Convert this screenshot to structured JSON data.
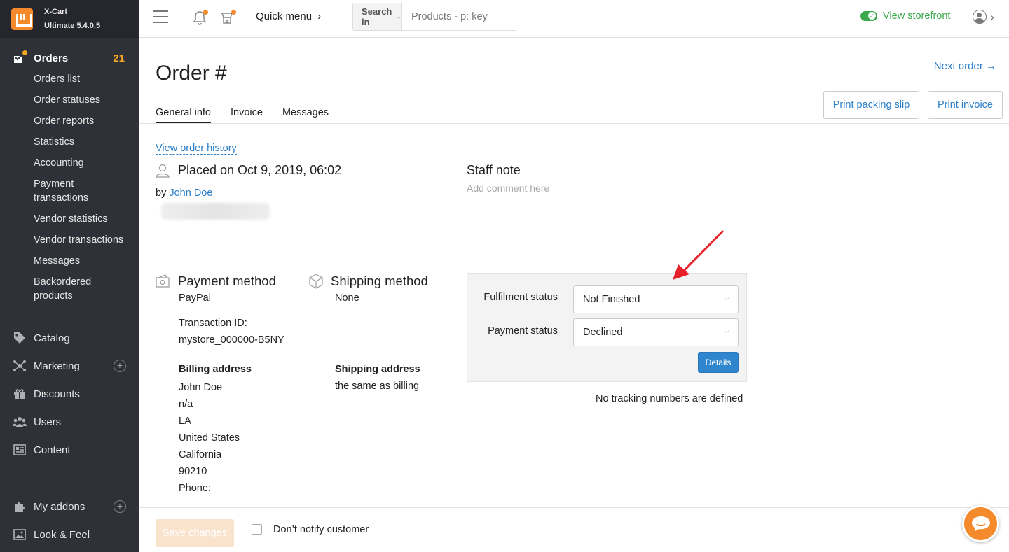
{
  "brand": {
    "name": "X-Cart",
    "edition": "Ultimate 5.4.0.5"
  },
  "sidebar": {
    "orders": {
      "label": "Orders",
      "count": "21"
    },
    "order_items": [
      {
        "label": "Orders list"
      },
      {
        "label": "Order statuses"
      },
      {
        "label": "Order reports"
      },
      {
        "label": "Statistics"
      },
      {
        "label": "Accounting"
      },
      {
        "label": "Payment transactions"
      },
      {
        "label": "Vendor statistics"
      },
      {
        "label": "Vendor transactions"
      },
      {
        "label": "Messages"
      },
      {
        "label": "Backordered products"
      }
    ],
    "sections": [
      {
        "label": "Catalog",
        "icon": "tag-icon"
      },
      {
        "label": "Marketing",
        "icon": "network-icon"
      },
      {
        "label": "Discounts",
        "icon": "gift-icon"
      },
      {
        "label": "Users",
        "icon": "users-icon"
      },
      {
        "label": "Content",
        "icon": "content-icon"
      }
    ],
    "bottom_sections": [
      {
        "label": "My addons",
        "icon": "puzzle-icon"
      },
      {
        "label": "Look & Feel",
        "icon": "image-icon"
      }
    ]
  },
  "topbar": {
    "quick_menu": "Quick menu",
    "search_in": "Search in",
    "search_placeholder": "Products - p: key",
    "view_storefront": "View storefront"
  },
  "order": {
    "title": "Order #",
    "next_order": "Next order →",
    "tabs": [
      {
        "label": "General info"
      },
      {
        "label": "Invoice"
      },
      {
        "label": "Messages"
      }
    ],
    "print_packing_slip": "Print packing slip",
    "print_invoice": "Print invoice",
    "view_history": "View order history",
    "placed_on": "Placed on Oct 9, 2019, 06:02",
    "by_label": "by",
    "customer": "John Doe",
    "staff_note_title": "Staff note",
    "staff_note_placeholder": "Add comment here",
    "payment": {
      "title": "Payment method",
      "method": "PayPal",
      "transaction_label": "Transaction ID:",
      "transaction_id": "mystore_000000-B5NY"
    },
    "shipping": {
      "title": "Shipping method",
      "method": "None"
    },
    "billing_address": {
      "title": "Billing address",
      "lines": [
        "John Doe",
        "n/a",
        "LA",
        "United States",
        "California",
        "90210",
        "Phone:"
      ]
    },
    "shipping_address": {
      "title": "Shipping address",
      "value": "the same as billing"
    },
    "fulfilment_label": "Fulfilment status",
    "fulfilment_value": "Not Finished",
    "payment_status_label": "Payment status",
    "payment_status_value": "Declined",
    "details_button": "Details",
    "no_tracking": "No tracking numbers are defined"
  },
  "footer": {
    "save_changes": "Save changes",
    "dont_notify": "Don’t notify customer"
  },
  "colors": {
    "accent": "#2a7fc9",
    "brand": "#f58a2c",
    "sidebar": "#2f3138",
    "storefront": "#3aa84b",
    "annotation": "#e8202a"
  }
}
